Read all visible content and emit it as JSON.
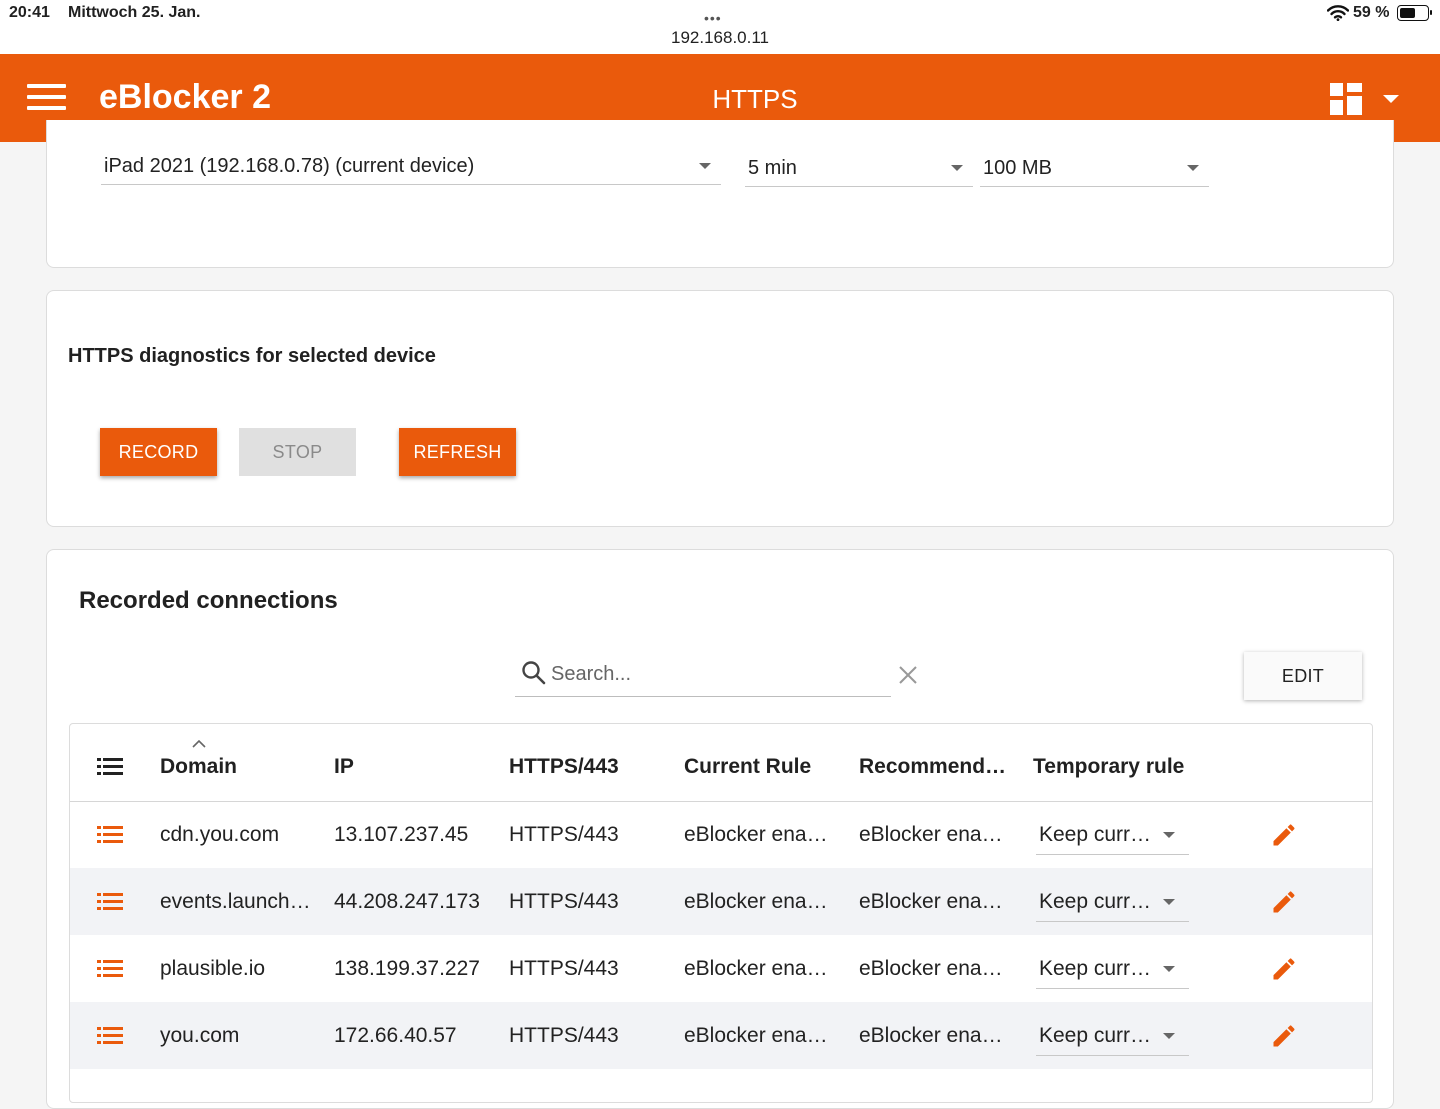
{
  "status_bar": {
    "time": "20:41",
    "date": "Mittwoch 25. Jan.",
    "dots": "•••",
    "url": "192.168.0.11",
    "battery_text": "59 %",
    "battery_level": 0.59
  },
  "toolbar": {
    "app_title": "eBlocker 2",
    "page_title": "HTTPS",
    "accent_color": "#ea5a0c"
  },
  "recording_settings": {
    "device_select": "iPad 2021 (192.168.0.78) (current device)",
    "duration_select": "5 min",
    "size_select": "100 MB"
  },
  "diagnostics": {
    "title": "HTTPS diagnostics for selected device",
    "record_label": "RECORD",
    "stop_label": "STOP",
    "refresh_label": "REFRESH"
  },
  "connections": {
    "title": "Recorded connections",
    "search_placeholder": "Search...",
    "edit_label": "EDIT",
    "columns": [
      "Domain",
      "IP",
      "HTTPS/443",
      "Current Rule",
      "Recommend…",
      "Temporary rule"
    ],
    "rows": [
      {
        "domain": "cdn.you.com",
        "ip": "13.107.237.45",
        "port": "HTTPS/443",
        "current_rule": "eBlocker ena…",
        "recommended": "eBlocker ena…",
        "temporary_rule": "Keep curr…"
      },
      {
        "domain": "events.launch…",
        "ip": "44.208.247.173",
        "port": "HTTPS/443",
        "current_rule": "eBlocker ena…",
        "recommended": "eBlocker ena…",
        "temporary_rule": "Keep curr…"
      },
      {
        "domain": "plausible.io",
        "ip": "138.199.37.227",
        "port": "HTTPS/443",
        "current_rule": "eBlocker ena…",
        "recommended": "eBlocker ena…",
        "temporary_rule": "Keep curr…"
      },
      {
        "domain": "you.com",
        "ip": "172.66.40.57",
        "port": "HTTPS/443",
        "current_rule": "eBlocker ena…",
        "recommended": "eBlocker ena…",
        "temporary_rule": "Keep curr…"
      }
    ]
  }
}
